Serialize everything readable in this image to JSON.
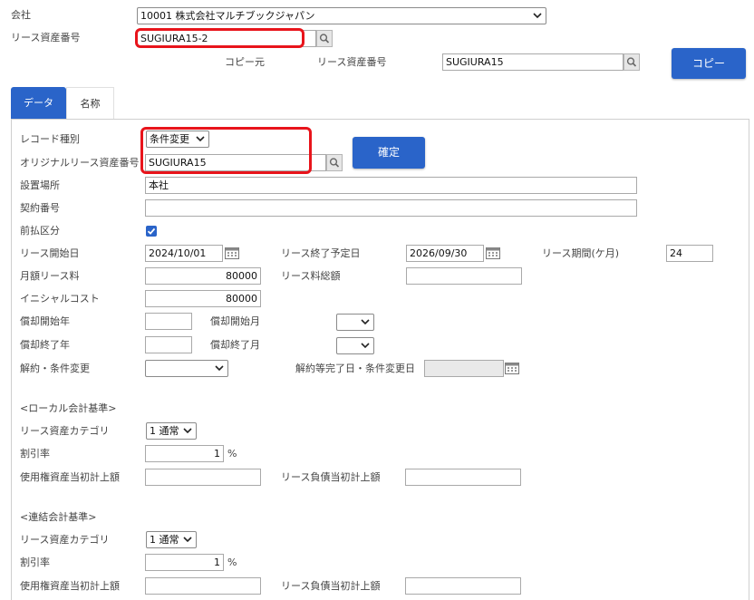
{
  "header": {
    "company_label": "会社",
    "company_value": "10001 株式会社マルチブックジャパン",
    "lease_asset_no_label": "リース資産番号",
    "lease_asset_no_value": "SUGIURA15-2",
    "copy_source_label": "コピー元",
    "copy_lease_asset_no_label": "リース資産番号",
    "copy_lease_asset_no_value": "SUGIURA15",
    "copy_button": "コピー"
  },
  "tabs": [
    {
      "label": "データ",
      "active": true
    },
    {
      "label": "名称",
      "active": false
    }
  ],
  "form": {
    "record_type_label": "レコード種別",
    "record_type_value": "条件変更",
    "original_no_label": "オリジナルリース資産番号",
    "original_no_value": "SUGIURA15",
    "confirm_button": "確定",
    "location_label": "設置場所",
    "location_value": "本社",
    "contract_no_label": "契約番号",
    "contract_no_value": "",
    "prepaid_label": "前払区分",
    "prepaid_checked": true,
    "lease_start_label": "リース開始日",
    "lease_start_value": "2024/10/01",
    "lease_end_label": "リース終了予定日",
    "lease_end_value": "2026/09/30",
    "lease_period_label": "リース期間(ケ月)",
    "lease_period_value": "24",
    "monthly_fee_label": "月額リース料",
    "monthly_fee_value": "80000",
    "total_fee_label": "リース料総額",
    "total_fee_value": "",
    "initial_cost_label": "イニシャルコスト",
    "initial_cost_value": "80000",
    "dep_start_year_label": "償却開始年",
    "dep_start_month_label": "償却開始月",
    "dep_end_year_label": "償却終了年",
    "dep_end_month_label": "償却終了月",
    "cancel_change_label": "解約・条件変更",
    "cancel_change_date_label": "解約等完了日・条件変更日"
  },
  "local": {
    "section_title": "<ローカル会計基準>",
    "category_label": "リース資産カテゴリ",
    "category_value": "1 通常",
    "discount_label": "割引率",
    "discount_value": "1",
    "percent": "%",
    "rou_label": "使用権資産当初計上額",
    "liability_label": "リース負債当初計上額"
  },
  "consolidated": {
    "section_title": "<連結会計基準>",
    "category_label": "リース資産カテゴリ",
    "category_value": "1 通常",
    "discount_label": "割引率",
    "discount_value": "1",
    "percent": "%",
    "rou_label": "使用権資産当初計上額",
    "liability_label": "リース負債当初計上額"
  },
  "colors": {
    "accent_blue": "#2a64c9",
    "highlight_red": "#e8141b",
    "panel_border": "#cfcfcf"
  }
}
